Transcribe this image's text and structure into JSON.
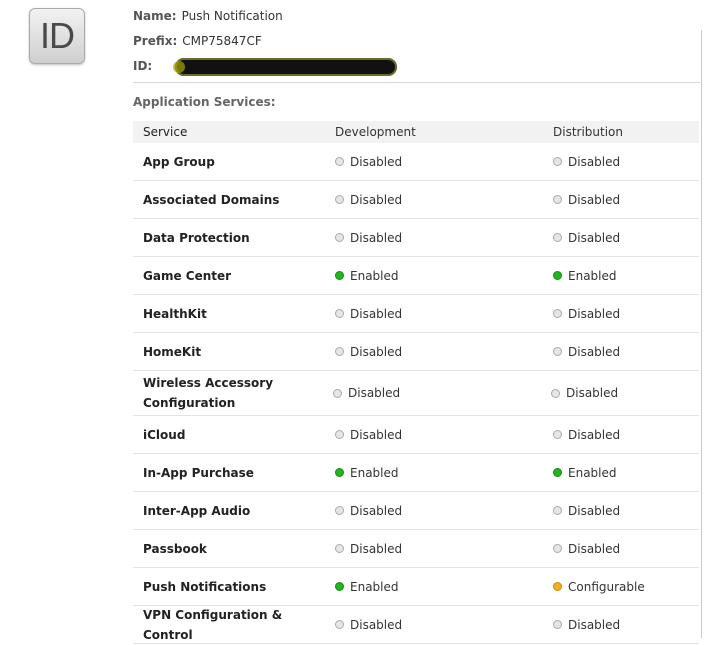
{
  "app_icon": {
    "label": "ID"
  },
  "meta": {
    "name_label": "Name:",
    "name_value": "Push Notification",
    "prefix_label": "Prefix:",
    "prefix_value": "CMP75847CF",
    "id_label": "ID:"
  },
  "section": {
    "title": "Application Services:"
  },
  "table": {
    "headers": [
      "Service",
      "Development",
      "Distribution"
    ],
    "rows": [
      {
        "service": "App Group",
        "dev": "Disabled",
        "dist": "Disabled"
      },
      {
        "service": "Associated Domains",
        "dev": "Disabled",
        "dist": "Disabled"
      },
      {
        "service": "Data Protection",
        "dev": "Disabled",
        "dist": "Disabled"
      },
      {
        "service": "Game Center",
        "dev": "Enabled",
        "dist": "Enabled"
      },
      {
        "service": "HealthKit",
        "dev": "Disabled",
        "dist": "Disabled"
      },
      {
        "service": "HomeKit",
        "dev": "Disabled",
        "dist": "Disabled"
      },
      {
        "service": "Wireless Accessory Configuration",
        "dev": "Disabled",
        "dist": "Disabled"
      },
      {
        "service": "iCloud",
        "dev": "Disabled",
        "dist": "Disabled"
      },
      {
        "service": "In-App Purchase",
        "dev": "Enabled",
        "dist": "Enabled"
      },
      {
        "service": "Inter-App Audio",
        "dev": "Disabled",
        "dist": "Disabled"
      },
      {
        "service": "Passbook",
        "dev": "Disabled",
        "dist": "Disabled"
      },
      {
        "service": "Push Notifications",
        "dev": "Enabled",
        "dist": "Configurable"
      },
      {
        "service": "VPN Configuration & Control",
        "dev": "Disabled",
        "dist": "Disabled"
      }
    ]
  },
  "status_colors": {
    "Enabled": "#1fb71f",
    "Disabled": "#e6e6e6",
    "Configurable": "#f2b11c"
  }
}
